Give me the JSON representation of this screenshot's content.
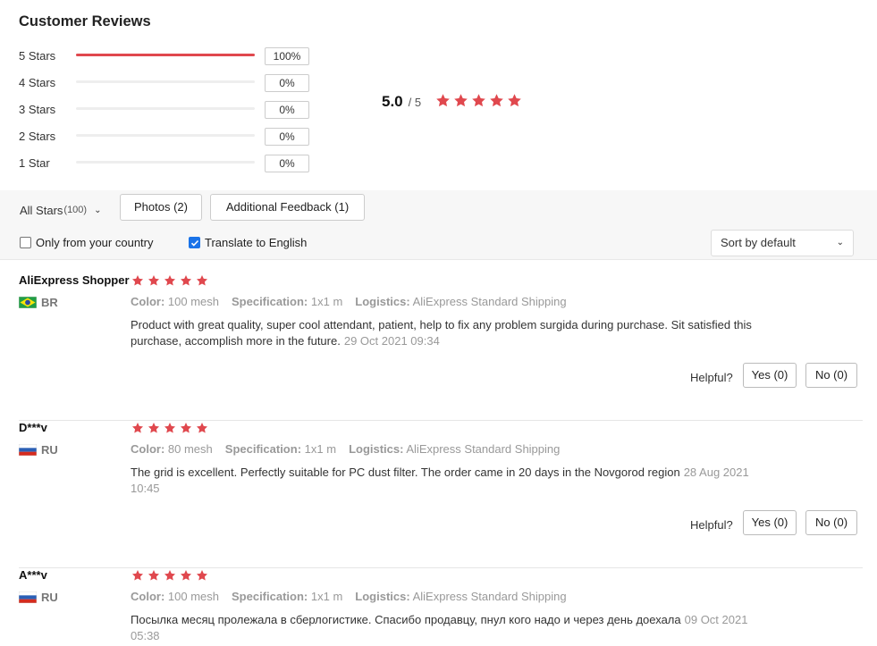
{
  "header": {
    "title": "Customer Reviews"
  },
  "rating_breakdown": [
    {
      "label": "5 Stars",
      "percent": 100,
      "percent_text": "100%"
    },
    {
      "label": "4 Stars",
      "percent": 0,
      "percent_text": "0%"
    },
    {
      "label": "3 Stars",
      "percent": 0,
      "percent_text": "0%"
    },
    {
      "label": "2 Stars",
      "percent": 0,
      "percent_text": "0%"
    },
    {
      "label": "1 Star",
      "percent": 0,
      "percent_text": "0%"
    }
  ],
  "average": {
    "score": "5.0",
    "out_of": "/ 5",
    "stars": 5
  },
  "filters": {
    "all_stars_label": "All Stars",
    "all_stars_count": "(100)",
    "photos_label": "Photos (2)",
    "feedback_label": "Additional Feedback (1)",
    "only_country_label": "Only from your country",
    "only_country_checked": false,
    "translate_label": "Translate to English",
    "translate_checked": true,
    "sort_label": "Sort by default"
  },
  "reviews": [
    {
      "name": "AliExpress Shopper",
      "country": "BR",
      "flag_icon": "brazil-flag",
      "stars": 5,
      "color_label": "Color:",
      "color": "100 mesh",
      "spec_label": "Specification:",
      "spec": "1x1 m",
      "logistics_label": "Logistics:",
      "logistics": "AliExpress Standard Shipping",
      "text": "Product with great quality, super cool attendant, patient, help to fix any problem surgida during purchase. Sit satisfied this purchase, accomplish more in the future.",
      "date": "29 Oct 2021 09:34",
      "helpful_label": "Helpful?",
      "yes_label": "Yes (0)",
      "no_label": "No (0)"
    },
    {
      "name": "D***v",
      "country": "RU",
      "flag_icon": "russia-flag",
      "stars": 5,
      "color_label": "Color:",
      "color": "80 mesh",
      "spec_label": "Specification:",
      "spec": "1x1 m",
      "logistics_label": "Logistics:",
      "logistics": "AliExpress Standard Shipping",
      "text": "The grid is excellent. Perfectly suitable for PC dust filter. The order came in 20 days in the Novgorod region",
      "date": "28 Aug 2021 10:45",
      "helpful_label": "Helpful?",
      "yes_label": "Yes (0)",
      "no_label": "No (0)"
    },
    {
      "name": "A***v",
      "country": "RU",
      "flag_icon": "russia-flag",
      "stars": 5,
      "color_label": "Color:",
      "color": "100 mesh",
      "spec_label": "Specification:",
      "spec": "1x1 m",
      "logistics_label": "Logistics:",
      "logistics": "AliExpress Standard Shipping",
      "text": "Посылка месяц пролежала в сберлогистике. Спасибо продавцу, пнул кого надо и через день доехала",
      "date": "09 Oct 2021 05:38"
    }
  ],
  "colors": {
    "accent": "#e0484e",
    "checkbox": "#1a73e8"
  }
}
